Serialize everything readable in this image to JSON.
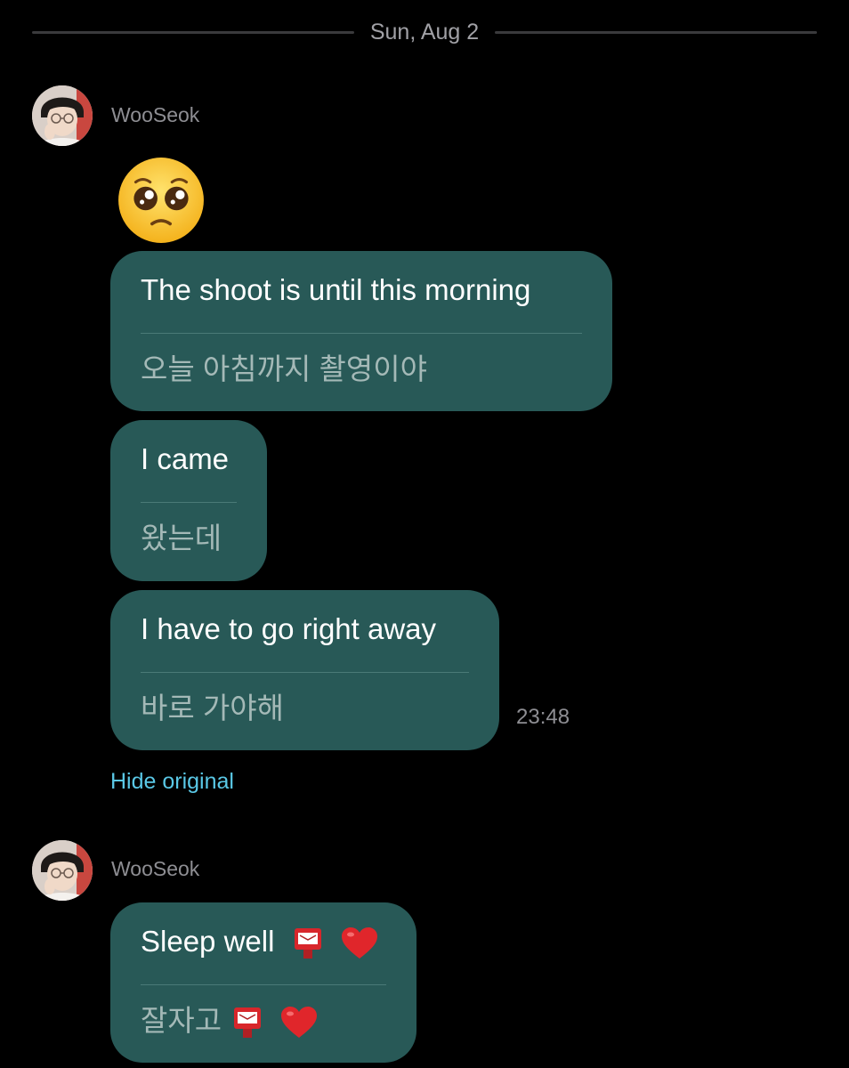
{
  "date_divider": "Sun, Aug 2",
  "groups": [
    {
      "sender": "WooSeok",
      "emoji": "pleading-face",
      "messages": [
        {
          "original": "The shoot is until this morning",
          "translation": "오늘 아침까지 촬영이야"
        },
        {
          "original": "I came",
          "translation": "왔는데"
        },
        {
          "original": "I have to go right away",
          "translation": "바로 가야해"
        }
      ],
      "timestamp": "23:48",
      "hide_original_label": "Hide original"
    },
    {
      "sender": "WooSeok",
      "messages": [
        {
          "original": "Sleep well",
          "translation": "잘자고",
          "trailing_icons": [
            "postbox-icon",
            "red-heart-icon"
          ]
        }
      ]
    }
  ],
  "colors": {
    "background": "#000000",
    "bubble": "#285957",
    "bubble_separator": "#4a7a77",
    "translation_text": "#a4b9b7",
    "link": "#5ac8e6",
    "meta_text": "#8e8e93"
  }
}
